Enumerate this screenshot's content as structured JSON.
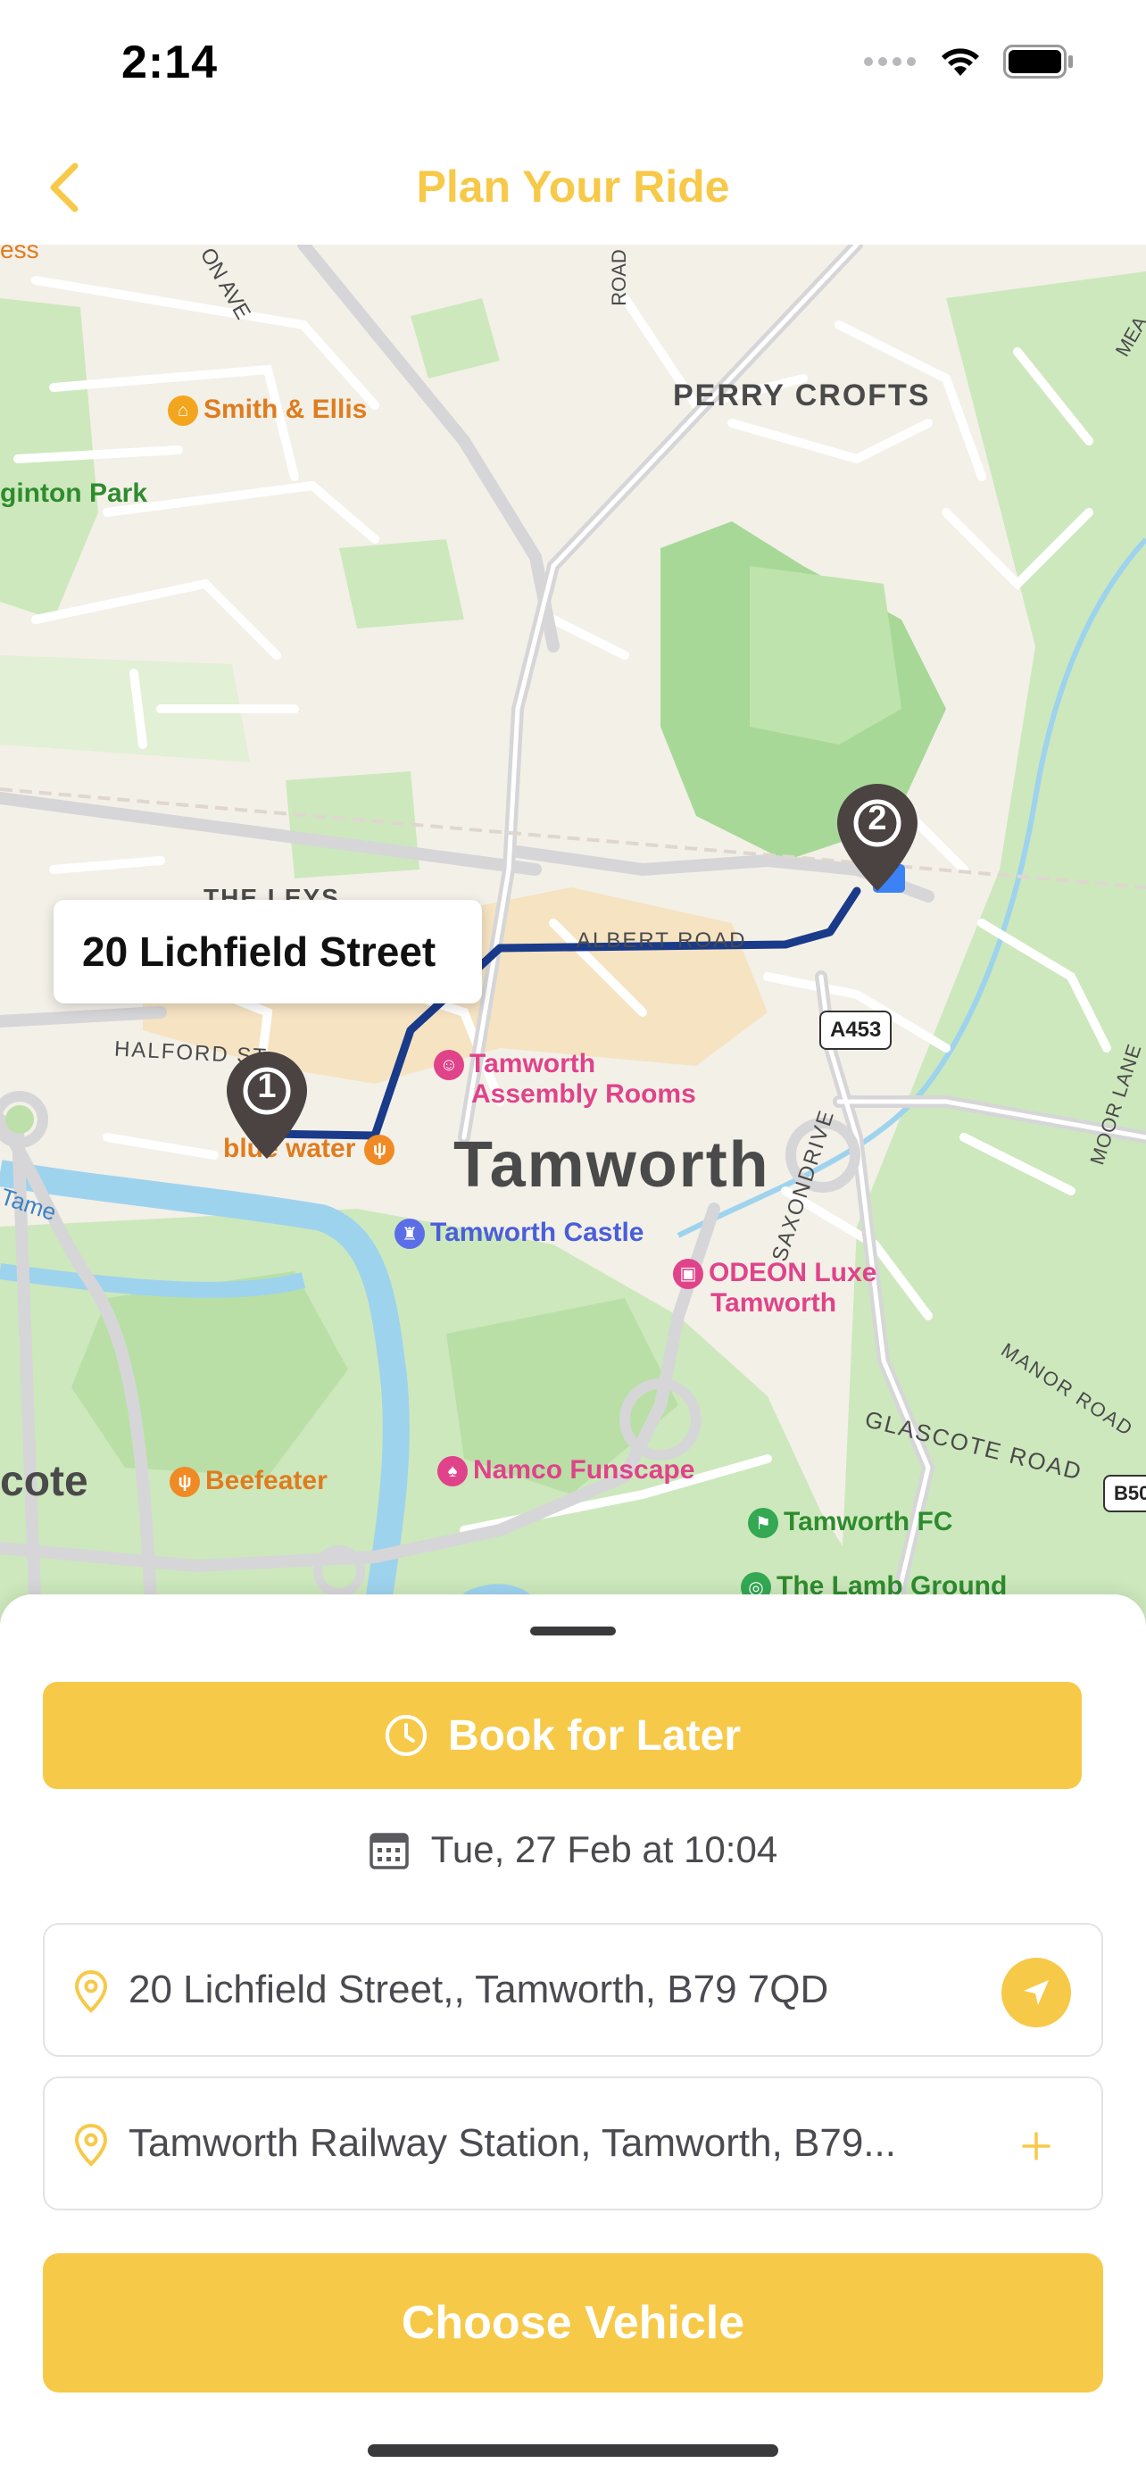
{
  "status_bar": {
    "time": "2:14"
  },
  "nav": {
    "title": "Plan Your Ride"
  },
  "map": {
    "callout": "20 Lichfield Street",
    "pins": [
      {
        "number": "1"
      },
      {
        "number": "2"
      }
    ],
    "labels": {
      "ess": "ess",
      "on_ave": "ON AVE",
      "road_top": "ROAD",
      "smith_ellis": "Smith & Ellis",
      "perry_crofts": "PERRY CROFTS",
      "ginton_park": "ginton Park",
      "mea": "MEA",
      "the_leys": "THE LEYS",
      "albert_road": "ALBERT ROAD",
      "halford": "HALFORD ST",
      "a453": "A453",
      "assembly1": "Tamworth",
      "assembly2": "Assembly Rooms",
      "blue_water": "blue water",
      "tamworth": "Tamworth",
      "saxondrive": "SAXONDRIVE",
      "moor_lane": "MOOR LANE",
      "tame": "Tame",
      "castle": "Tamworth Castle",
      "odeon1": "ODEON Luxe",
      "odeon2": "Tamworth",
      "manor_road": "MANOR ROAD",
      "glascote_road": "GLASCOTE ROAD",
      "b50": "B50",
      "cote": "cote",
      "beefeater": "Beefeater",
      "namco": "Namco Funscape",
      "tamworth_fc": "Tamworth FC",
      "lamb_ground": "The Lamb Ground"
    }
  },
  "sheet": {
    "book_later": "Book for Later",
    "date": "Tue, 27 Feb at 10:04",
    "pickup": "20 Lichfield Street,, Tamworth, B79 7QD",
    "dropoff": "Tamworth Railway Station, Tamworth, B79...",
    "choose_vehicle": "Choose Vehicle"
  },
  "colors": {
    "accent": "#f7c948",
    "route": "#1a3a8a",
    "pin": "#4a4341"
  }
}
